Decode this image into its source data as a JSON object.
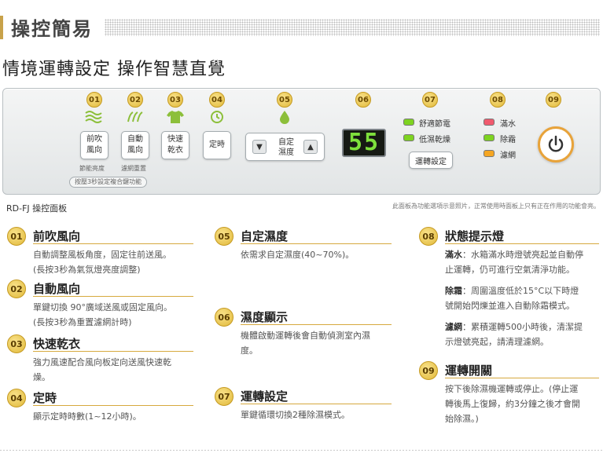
{
  "header": {
    "title": "操控簡易",
    "subtitle": "情境運轉設定 操作智慧直覺"
  },
  "panel": {
    "badges": [
      "01",
      "02",
      "03",
      "04",
      "05",
      "06",
      "07",
      "08",
      "09"
    ],
    "buttons": {
      "b01": [
        "前吹",
        "風向"
      ],
      "b02": [
        "自動",
        "風向"
      ],
      "b03": [
        "快速",
        "乾衣"
      ],
      "b04": "定時",
      "b05": [
        "自定",
        "濕度"
      ],
      "arrow_down": "▼",
      "arrow_up": "▲",
      "mode": "運轉設定"
    },
    "small_labels": {
      "brightness": "節能亮度",
      "filter_reset": "濾網重置",
      "hint": "按壓3秒設定複合鍵功能"
    },
    "display_value": "55",
    "modes": [
      {
        "label": "舒適節電",
        "color": "#7ed321"
      },
      {
        "label": "低濕乾燥",
        "color": "#7ed321"
      }
    ],
    "status": [
      {
        "label": "滿水",
        "color": "#f05a6e"
      },
      {
        "label": "除霜",
        "color": "#7ed321"
      },
      {
        "label": "濾網",
        "color": "#f5a623"
      }
    ],
    "icons": [
      "wind-icon",
      "swing-icon",
      "shirt-icon",
      "timer-icon",
      "drop-icon",
      "power-icon"
    ],
    "accent_green": "#8cbf3a",
    "accent_orange": "#e8a33a",
    "caption": "RD-FJ 操控面板",
    "note": "此面板為功能選項示意照片，正常使用時面板上只有正在作用的功能會亮。"
  },
  "sections": [
    {
      "num": "01",
      "title": "前吹風向",
      "lines": [
        "自動調整風板角度，固定往前送風。",
        "(長按3秒為氣氛燈亮度調整)"
      ]
    },
    {
      "num": "02",
      "title": "自動風向",
      "lines": [
        "單鍵切換 90°廣域送風或固定風向。",
        "(長按3秒為重置濾網計時)"
      ]
    },
    {
      "num": "03",
      "title": "快速乾衣",
      "lines": [
        "強力風速配合風向板定向送風快速乾",
        "燥。"
      ]
    },
    {
      "num": "04",
      "title": "定時",
      "lines": [
        "顯示定時時數(1~12小時)。"
      ]
    },
    {
      "num": "05",
      "title": "自定濕度",
      "lines": [
        "依需求自定濕度(40~70%)。"
      ]
    },
    {
      "num": "06",
      "title": "濕度顯示",
      "lines": [
        "機體啟動運轉後會自動偵測室內濕",
        "度。"
      ]
    },
    {
      "num": "07",
      "title": "運轉設定",
      "lines": [
        "單鍵循環切換2種除濕模式。"
      ]
    },
    {
      "num": "08",
      "title": "狀態提示燈",
      "items": [
        {
          "term": "滿水",
          "lines": [
            "：水箱滿水時燈號亮起並自動停",
            "止運轉，仍可進行空氣清淨功能。"
          ]
        },
        {
          "term": "除霜",
          "lines": [
            "：周圍溫度低於15°C以下時燈",
            "號開始閃爍並進入自動除霜模式。"
          ]
        },
        {
          "term": "濾網",
          "lines": [
            "：累積運轉500小時後，清潔提",
            "示燈號亮起，請清理濾網。"
          ]
        }
      ]
    },
    {
      "num": "09",
      "title": "運轉開關",
      "lines": [
        "按下後除濕機運轉或停止。(停止運",
        "轉後馬上復歸，約3分鐘之後才會開",
        "始除濕。)"
      ]
    }
  ]
}
